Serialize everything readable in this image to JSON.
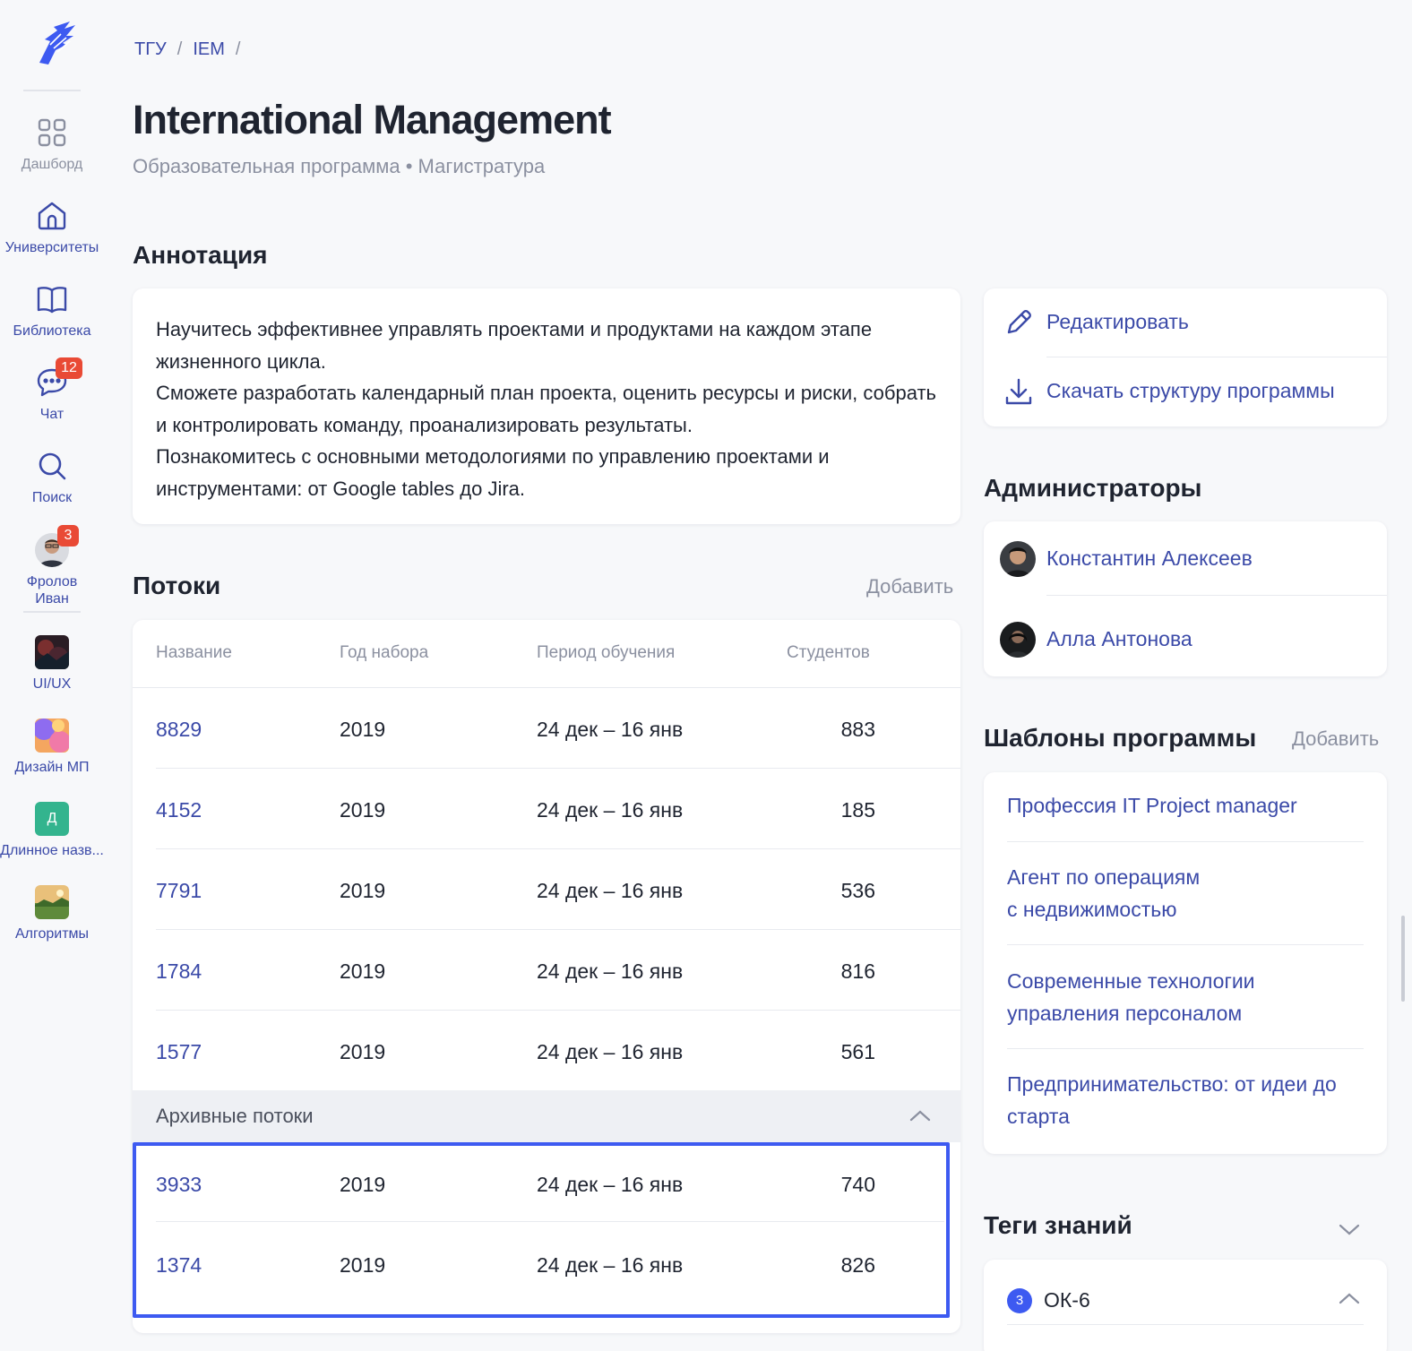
{
  "sidebar": {
    "items": [
      {
        "label": "Дашборд"
      },
      {
        "label": "Университеты"
      },
      {
        "label": "Библиотека"
      },
      {
        "label": "Чат",
        "badge": "12"
      },
      {
        "label": "Поиск"
      },
      {
        "label": "Фролов\nИван",
        "badge": "3"
      },
      {
        "label": "UI/UX"
      },
      {
        "label": "Дизайн МП"
      },
      {
        "label": "Длинное назв...",
        "initial": "Д"
      },
      {
        "label": "Алгоритмы"
      }
    ]
  },
  "breadcrumb": [
    "ТГУ",
    "IEM"
  ],
  "page": {
    "title": "International Management",
    "subtitle": "Образовательная программа • Магистратура"
  },
  "annotation": {
    "title": "Аннотация",
    "text": "Научитесь эффективнее управлять проектами и продуктами на каждом этапе жизненного цикла.\nСможете разработать календарный план проекта, оценить ресурсы и риски, собрать и контролировать команду, проанализировать результаты.\nПознакомитесь с основными методологиями по управлению проектами и инструментами: от Google tables до Jira."
  },
  "streams": {
    "title": "Потоки",
    "add_label": "Добавить",
    "columns": [
      "Название",
      "Год набора",
      "Период обучения",
      "Студентов"
    ],
    "rows": [
      {
        "name": "8829",
        "year": "2019",
        "period": "24 дек – 16 янв",
        "students": "883"
      },
      {
        "name": "4152",
        "year": "2019",
        "period": "24 дек – 16 янв",
        "students": "185"
      },
      {
        "name": "7791",
        "year": "2019",
        "period": "24 дек – 16 янв",
        "students": "536"
      },
      {
        "name": "1784",
        "year": "2019",
        "period": "24 дек – 16 янв",
        "students": "816"
      },
      {
        "name": "1577",
        "year": "2019",
        "period": "24 дек – 16 янв",
        "students": "561"
      }
    ],
    "archive_label": "Архивные потоки",
    "archive_rows": [
      {
        "name": "3933",
        "year": "2019",
        "period": "24 дек – 16 янв",
        "students": "740"
      },
      {
        "name": "1374",
        "year": "2019",
        "period": "24 дек – 16 янв",
        "students": "826"
      }
    ]
  },
  "actions": {
    "edit_label": "Редактировать",
    "download_label": "Скачать структуру программы"
  },
  "admins": {
    "title": "Администраторы",
    "people": [
      {
        "name": "Константин Алексеев"
      },
      {
        "name": "Алла Антонова"
      }
    ]
  },
  "templates": {
    "title": "Шаблоны программы",
    "add_label": "Добавить",
    "items": [
      "Профессия IT Project manager",
      "Агент по операциям\nс недвижимостью",
      "Современные технологии\nуправления персоналом",
      "Предпринимательство: от идеи до старта"
    ]
  },
  "tags": {
    "title": "Теги знаний",
    "items": [
      {
        "count": "3",
        "name": "ОК-6"
      }
    ]
  },
  "colors": {
    "accent": "#3b4aa8",
    "highlight": "#3d5af1",
    "badge": "#e94a35",
    "muted": "#8b90a0",
    "background": "#f7f8fa"
  }
}
